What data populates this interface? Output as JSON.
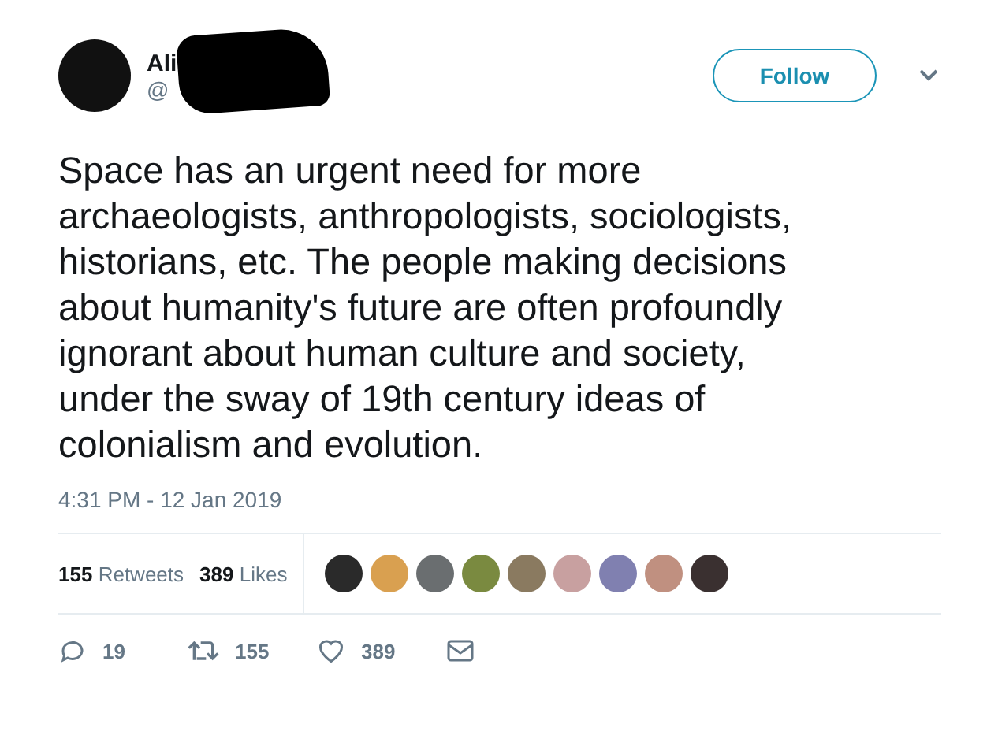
{
  "author": {
    "name_visible": "Ali",
    "handle_visible": "@",
    "redacted": true
  },
  "follow_button": "Follow",
  "text_lines": [
    "Space has an urgent need for more",
    "archaeologists, anthropologists, sociologists,",
    "historians, etc. The people making decisions",
    "about humanity's future are often profoundly",
    "ignorant about human culture and society,",
    "under the sway of 19th century ideas of",
    "colonialism and evolution."
  ],
  "timestamp": "4:31 PM - 12 Jan 2019",
  "stats": [
    {
      "count": "155",
      "label": "Retweets"
    },
    {
      "count": "389",
      "label": "Likes"
    }
  ],
  "likers": [
    {
      "color": "#2a2a2a"
    },
    {
      "color": "#d9a050"
    },
    {
      "color": "#6a6e70"
    },
    {
      "color": "#7a8a40"
    },
    {
      "color": "#8a7a60"
    },
    {
      "color": "#c8a0a0"
    },
    {
      "color": "#8080b0"
    },
    {
      "color": "#c09080"
    },
    {
      "color": "#3a3030"
    }
  ],
  "actions": [
    {
      "kind": "reply",
      "count": "19"
    },
    {
      "kind": "retweet",
      "count": "155"
    },
    {
      "kind": "like",
      "count": "389"
    },
    {
      "kind": "message"
    }
  ]
}
